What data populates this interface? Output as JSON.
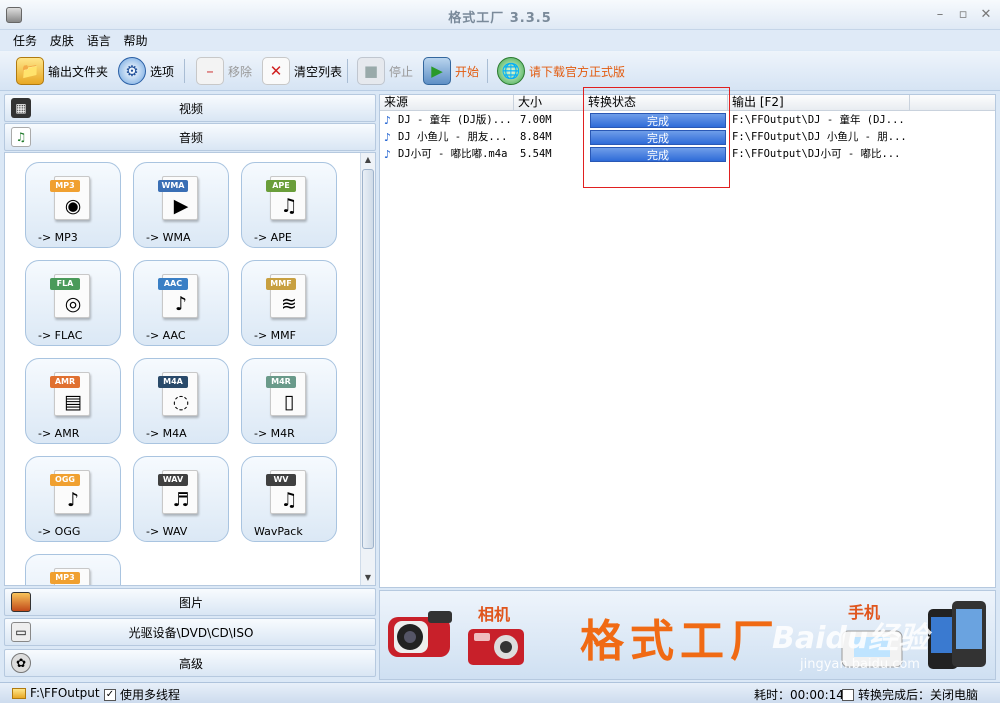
{
  "window": {
    "title": "格式工厂 3.3.5"
  },
  "menu": [
    "任务",
    "皮肤",
    "语言",
    "帮助"
  ],
  "toolbar": {
    "output_folder": "输出文件夹",
    "options": "选项",
    "remove": "移除",
    "clear_list": "清空列表",
    "stop": "停止",
    "start": "开始",
    "download_official": "请下载官方正式版"
  },
  "categories": {
    "video": "视频",
    "audio": "音频",
    "picture": "图片",
    "rom": "光驱设备\\DVD\\CD\\ISO",
    "advanced": "高级"
  },
  "formats": [
    {
      "badge": "MP3",
      "label": "-> MP3",
      "color": "#f0a030",
      "glyph": "◉"
    },
    {
      "badge": "WMA",
      "label": "-> WMA",
      "color": "#3a6fb5",
      "glyph": "▶"
    },
    {
      "badge": "APE",
      "label": "-> APE",
      "color": "#6a9e3a",
      "glyph": "♫"
    },
    {
      "badge": "FLA",
      "label": "-> FLAC",
      "color": "#4a9a5a",
      "glyph": "◎"
    },
    {
      "badge": "AAC",
      "label": "-> AAC",
      "color": "#3a7fc5",
      "glyph": "♪"
    },
    {
      "badge": "MMF",
      "label": "-> MMF",
      "color": "#c8a040",
      "glyph": "≋"
    },
    {
      "badge": "AMR",
      "label": "-> AMR",
      "color": "#e07030",
      "glyph": "▤"
    },
    {
      "badge": "M4A",
      "label": "-> M4A",
      "color": "#2a4a6a",
      "glyph": "◌"
    },
    {
      "badge": "M4R",
      "label": "-> M4R",
      "color": "#6a9a8a",
      "glyph": "▯"
    },
    {
      "badge": "OGG",
      "label": "-> OGG",
      "color": "#f0a030",
      "glyph": "♪"
    },
    {
      "badge": "WAV",
      "label": "-> WAV",
      "color": "#404040",
      "glyph": "♬"
    },
    {
      "badge": "WV",
      "label": "WavPack",
      "color": "#404040",
      "glyph": "♫"
    },
    {
      "badge": "MP3",
      "label": "",
      "color": "#f0a030",
      "glyph": ""
    }
  ],
  "filelist": {
    "headers": {
      "source": "来源",
      "size": "大小",
      "status": "转换状态",
      "output": "输出 [F2]"
    },
    "rows": [
      {
        "source": "DJ - 童年 (DJ版)...",
        "size": "7.00M",
        "status": "完成",
        "output": "F:\\FFOutput\\DJ - 童年 (DJ..."
      },
      {
        "source": "DJ 小鱼儿 - 朋友...",
        "size": "8.84M",
        "status": "完成",
        "output": "F:\\FFOutput\\DJ 小鱼儿 - 朋..."
      },
      {
        "source": "DJ小可 - 嘟比嘟.m4a",
        "size": "5.54M",
        "status": "完成",
        "output": "F:\\FFOutput\\DJ小可 - 嘟比..."
      }
    ]
  },
  "banner": {
    "headline": "格式工厂",
    "camera_label": "相机",
    "phone_label": "手机",
    "watermark": "Baidu经验",
    "watermark_url": "jingyan.baidu.com"
  },
  "statusbar": {
    "output_path": "F:\\FFOutput",
    "multithread": "使用多线程",
    "elapsed": "耗时：00:00:14",
    "after_done": "转换完成后：关闭电脑"
  }
}
